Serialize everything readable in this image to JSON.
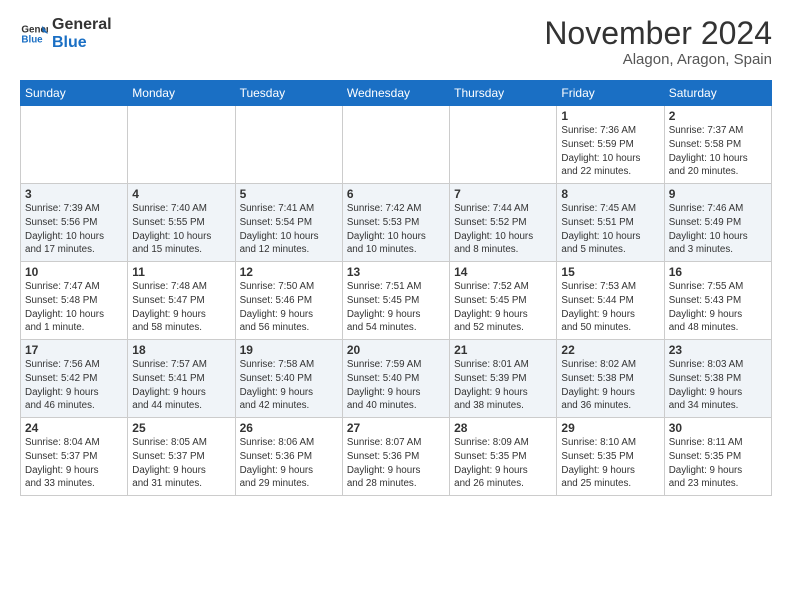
{
  "header": {
    "logo_line1": "General",
    "logo_line2": "Blue",
    "month": "November 2024",
    "location": "Alagon, Aragon, Spain"
  },
  "weekdays": [
    "Sunday",
    "Monday",
    "Tuesday",
    "Wednesday",
    "Thursday",
    "Friday",
    "Saturday"
  ],
  "weeks": [
    [
      {
        "day": "",
        "info": ""
      },
      {
        "day": "",
        "info": ""
      },
      {
        "day": "",
        "info": ""
      },
      {
        "day": "",
        "info": ""
      },
      {
        "day": "",
        "info": ""
      },
      {
        "day": "1",
        "info": "Sunrise: 7:36 AM\nSunset: 5:59 PM\nDaylight: 10 hours\nand 22 minutes."
      },
      {
        "day": "2",
        "info": "Sunrise: 7:37 AM\nSunset: 5:58 PM\nDaylight: 10 hours\nand 20 minutes."
      }
    ],
    [
      {
        "day": "3",
        "info": "Sunrise: 7:39 AM\nSunset: 5:56 PM\nDaylight: 10 hours\nand 17 minutes."
      },
      {
        "day": "4",
        "info": "Sunrise: 7:40 AM\nSunset: 5:55 PM\nDaylight: 10 hours\nand 15 minutes."
      },
      {
        "day": "5",
        "info": "Sunrise: 7:41 AM\nSunset: 5:54 PM\nDaylight: 10 hours\nand 12 minutes."
      },
      {
        "day": "6",
        "info": "Sunrise: 7:42 AM\nSunset: 5:53 PM\nDaylight: 10 hours\nand 10 minutes."
      },
      {
        "day": "7",
        "info": "Sunrise: 7:44 AM\nSunset: 5:52 PM\nDaylight: 10 hours\nand 8 minutes."
      },
      {
        "day": "8",
        "info": "Sunrise: 7:45 AM\nSunset: 5:51 PM\nDaylight: 10 hours\nand 5 minutes."
      },
      {
        "day": "9",
        "info": "Sunrise: 7:46 AM\nSunset: 5:49 PM\nDaylight: 10 hours\nand 3 minutes."
      }
    ],
    [
      {
        "day": "10",
        "info": "Sunrise: 7:47 AM\nSunset: 5:48 PM\nDaylight: 10 hours\nand 1 minute."
      },
      {
        "day": "11",
        "info": "Sunrise: 7:48 AM\nSunset: 5:47 PM\nDaylight: 9 hours\nand 58 minutes."
      },
      {
        "day": "12",
        "info": "Sunrise: 7:50 AM\nSunset: 5:46 PM\nDaylight: 9 hours\nand 56 minutes."
      },
      {
        "day": "13",
        "info": "Sunrise: 7:51 AM\nSunset: 5:45 PM\nDaylight: 9 hours\nand 54 minutes."
      },
      {
        "day": "14",
        "info": "Sunrise: 7:52 AM\nSunset: 5:45 PM\nDaylight: 9 hours\nand 52 minutes."
      },
      {
        "day": "15",
        "info": "Sunrise: 7:53 AM\nSunset: 5:44 PM\nDaylight: 9 hours\nand 50 minutes."
      },
      {
        "day": "16",
        "info": "Sunrise: 7:55 AM\nSunset: 5:43 PM\nDaylight: 9 hours\nand 48 minutes."
      }
    ],
    [
      {
        "day": "17",
        "info": "Sunrise: 7:56 AM\nSunset: 5:42 PM\nDaylight: 9 hours\nand 46 minutes."
      },
      {
        "day": "18",
        "info": "Sunrise: 7:57 AM\nSunset: 5:41 PM\nDaylight: 9 hours\nand 44 minutes."
      },
      {
        "day": "19",
        "info": "Sunrise: 7:58 AM\nSunset: 5:40 PM\nDaylight: 9 hours\nand 42 minutes."
      },
      {
        "day": "20",
        "info": "Sunrise: 7:59 AM\nSunset: 5:40 PM\nDaylight: 9 hours\nand 40 minutes."
      },
      {
        "day": "21",
        "info": "Sunrise: 8:01 AM\nSunset: 5:39 PM\nDaylight: 9 hours\nand 38 minutes."
      },
      {
        "day": "22",
        "info": "Sunrise: 8:02 AM\nSunset: 5:38 PM\nDaylight: 9 hours\nand 36 minutes."
      },
      {
        "day": "23",
        "info": "Sunrise: 8:03 AM\nSunset: 5:38 PM\nDaylight: 9 hours\nand 34 minutes."
      }
    ],
    [
      {
        "day": "24",
        "info": "Sunrise: 8:04 AM\nSunset: 5:37 PM\nDaylight: 9 hours\nand 33 minutes."
      },
      {
        "day": "25",
        "info": "Sunrise: 8:05 AM\nSunset: 5:37 PM\nDaylight: 9 hours\nand 31 minutes."
      },
      {
        "day": "26",
        "info": "Sunrise: 8:06 AM\nSunset: 5:36 PM\nDaylight: 9 hours\nand 29 minutes."
      },
      {
        "day": "27",
        "info": "Sunrise: 8:07 AM\nSunset: 5:36 PM\nDaylight: 9 hours\nand 28 minutes."
      },
      {
        "day": "28",
        "info": "Sunrise: 8:09 AM\nSunset: 5:35 PM\nDaylight: 9 hours\nand 26 minutes."
      },
      {
        "day": "29",
        "info": "Sunrise: 8:10 AM\nSunset: 5:35 PM\nDaylight: 9 hours\nand 25 minutes."
      },
      {
        "day": "30",
        "info": "Sunrise: 8:11 AM\nSunset: 5:35 PM\nDaylight: 9 hours\nand 23 minutes."
      }
    ]
  ]
}
